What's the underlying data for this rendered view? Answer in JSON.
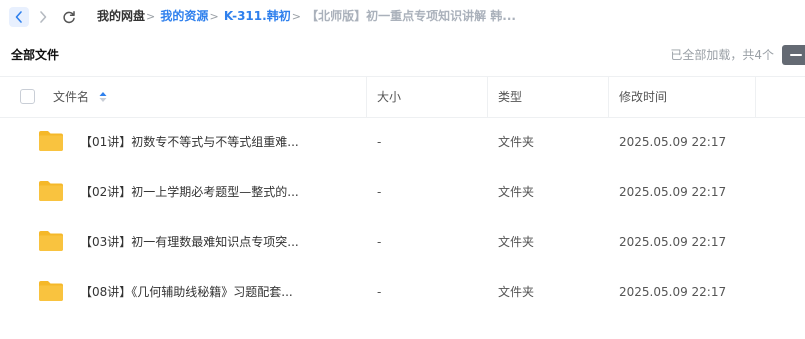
{
  "nav": {
    "back_icon": "chevron-left-icon",
    "forward_icon": "chevron-right-icon",
    "refresh_icon": "refresh-icon"
  },
  "breadcrumb": {
    "home": "我的网盘",
    "items": [
      "我的资源",
      "K-311.韩初"
    ],
    "current": "【北师版】初一重点专项知识讲解 韩..."
  },
  "header": {
    "title": "全部文件",
    "loaded_info": "已全部加载，共4个"
  },
  "table": {
    "columns": {
      "name": "文件名",
      "size": "大小",
      "type": "类型",
      "modified": "修改时间"
    },
    "rows": [
      {
        "name": "【01讲】初数专不等式与不等式组重难...",
        "size": "-",
        "type": "文件夹",
        "modified": "2025.05.09 22:17"
      },
      {
        "name": "【02讲】初一上学期必考题型—整式的...",
        "size": "-",
        "type": "文件夹",
        "modified": "2025.05.09 22:17"
      },
      {
        "name": "【03讲】初一有理数最难知识点专项突...",
        "size": "-",
        "type": "文件夹",
        "modified": "2025.05.09 22:17"
      },
      {
        "name": "【08讲】《几何辅助线秘籍》习题配套...",
        "size": "-",
        "type": "文件夹",
        "modified": "2025.05.09 22:17"
      }
    ]
  },
  "colors": {
    "accent": "#2f80ed",
    "folder": "#f9c33f",
    "folder_tab": "#f5b829"
  }
}
